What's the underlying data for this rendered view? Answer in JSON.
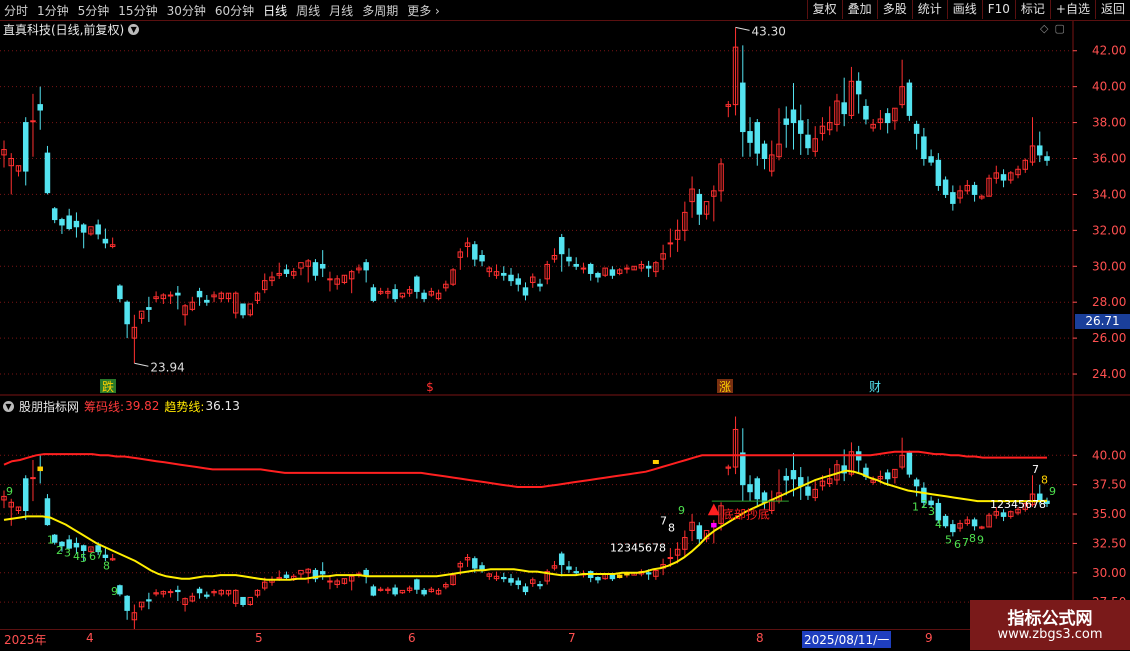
{
  "toolbar": {
    "periods": [
      "分时",
      "1分钟",
      "5分钟",
      "15分钟",
      "30分钟",
      "60分钟",
      "日线",
      "周线",
      "月线",
      "多周期",
      "更多"
    ],
    "active_period": "日线",
    "buttons": [
      "复权",
      "叠加",
      "多股",
      "统计",
      "画线",
      "F10",
      "标记",
      "+自选",
      "返回"
    ]
  },
  "main": {
    "stock_title": "直真科技(日线,前复权)",
    "current_price": "26.71"
  },
  "indicator": {
    "name": "股朋指标网",
    "line1_label": "筹码线:",
    "line1_value": "39.82",
    "line2_label": "趋势线:",
    "line2_value": "36.13"
  },
  "date_axis": {
    "labels": [
      "2025年",
      "4",
      "5",
      "6",
      "7",
      "8",
      "2025/08/11/一",
      "9"
    ]
  },
  "watermark": {
    "line1": "指标公式网",
    "line2": "www.zbgs3.com"
  },
  "colors": {
    "up": "#ff3030",
    "down": "#54e3f0",
    "chip": "#ff2020",
    "trend": "#ffee00",
    "grid": "#7a1414",
    "axis": "#ff5050"
  },
  "chart_data": [
    {
      "type": "candlestick",
      "title": "直真科技(日线,前复权)",
      "ylim": [
        23,
        43.6
      ],
      "y_ticks": [
        "42.00",
        "40.00",
        "38.00",
        "36.00",
        "34.00",
        "32.00",
        "30.00",
        "28.00",
        "26.00",
        "24.00"
      ],
      "annotations": {
        "high": "43.30",
        "low": "23.94"
      },
      "event_markers": [
        "跌",
        "$",
        "涨",
        "财"
      ],
      "candles": [
        [
          36.2,
          37.0,
          36.5,
          35.5
        ],
        [
          35.6,
          36.3,
          36.0,
          34.0
        ],
        [
          35.3,
          35.6,
          35.6,
          35.0
        ],
        [
          38.0,
          38.3,
          35.3,
          34.5
        ],
        [
          38.1,
          39.6,
          38.1,
          36.1
        ],
        [
          39.0,
          40.0,
          38.7,
          37.6
        ],
        [
          36.3,
          36.7,
          34.1,
          34.0
        ],
        [
          33.2,
          33.3,
          32.6,
          32.4
        ],
        [
          32.6,
          32.7,
          32.3,
          31.8
        ],
        [
          32.8,
          33.2,
          32.1,
          32.0
        ],
        [
          32.5,
          33.0,
          32.2,
          31.6
        ],
        [
          32.3,
          32.4,
          31.9,
          31.0
        ],
        [
          31.8,
          32.1,
          32.2,
          31.7
        ],
        [
          32.3,
          32.6,
          31.8,
          31.5
        ],
        [
          31.5,
          32.1,
          31.3,
          31.0
        ],
        [
          31.1,
          31.6,
          31.2,
          31.0
        ],
        [
          28.9,
          29.0,
          28.2,
          28.0
        ],
        [
          28.0,
          28.1,
          26.8,
          26.0
        ],
        [
          26.0,
          27.3,
          26.6,
          24.6
        ],
        [
          27.1,
          27.4,
          27.5,
          26.8
        ],
        [
          27.7,
          28.3,
          27.6,
          26.9
        ],
        [
          28.2,
          28.6,
          28.3,
          28.0
        ],
        [
          28.2,
          28.5,
          28.4,
          27.9
        ],
        [
          28.4,
          28.6,
          28.4,
          27.9
        ],
        [
          28.5,
          28.9,
          28.4,
          27.6
        ],
        [
          27.3,
          27.9,
          27.8,
          26.7
        ],
        [
          27.6,
          28.3,
          28.0,
          27.5
        ],
        [
          28.6,
          28.8,
          28.3,
          27.8
        ],
        [
          28.1,
          28.4,
          28.0,
          27.8
        ],
        [
          28.3,
          28.6,
          28.4,
          28.0
        ],
        [
          28.2,
          28.6,
          28.5,
          28.0
        ],
        [
          28.2,
          28.5,
          28.5,
          28.0
        ],
        [
          27.4,
          28.6,
          28.5,
          27.1
        ],
        [
          27.9,
          27.9,
          27.3,
          27.1
        ],
        [
          27.3,
          27.6,
          27.9,
          27.2
        ],
        [
          28.1,
          28.6,
          28.5,
          27.9
        ],
        [
          28.7,
          29.6,
          29.2,
          28.5
        ],
        [
          29.2,
          29.7,
          29.4,
          28.9
        ],
        [
          29.5,
          30.2,
          29.6,
          29.3
        ],
        [
          29.8,
          30.1,
          29.6,
          29.4
        ],
        [
          29.5,
          29.9,
          29.7,
          29.3
        ],
        [
          29.9,
          29.9,
          30.2,
          29.5
        ],
        [
          30.0,
          30.4,
          30.3,
          29.1
        ],
        [
          30.2,
          30.4,
          29.5,
          29.2
        ],
        [
          30.1,
          30.9,
          29.9,
          29.4
        ],
        [
          29.3,
          29.7,
          29.3,
          28.6
        ],
        [
          29.0,
          29.5,
          29.3,
          28.7
        ],
        [
          29.1,
          29.5,
          29.5,
          29.0
        ],
        [
          29.3,
          29.8,
          29.7,
          28.5
        ],
        [
          29.8,
          30.1,
          29.9,
          29.6
        ],
        [
          30.2,
          30.4,
          29.8,
          29.1
        ],
        [
          28.8,
          29.0,
          28.1,
          28.0
        ],
        [
          28.5,
          28.8,
          28.6,
          28.4
        ],
        [
          28.5,
          28.8,
          28.6,
          28.2
        ],
        [
          28.7,
          29.0,
          28.2,
          28.0
        ],
        [
          28.3,
          28.4,
          28.5,
          28.2
        ],
        [
          28.5,
          28.9,
          28.7,
          28.3
        ],
        [
          29.4,
          29.5,
          28.6,
          28.2
        ],
        [
          28.5,
          28.7,
          28.2,
          28.0
        ],
        [
          28.4,
          28.8,
          28.6,
          28.3
        ],
        [
          28.2,
          28.7,
          28.5,
          28.1
        ],
        [
          28.8,
          29.2,
          29.0,
          28.6
        ],
        [
          29.0,
          29.9,
          29.8,
          28.9
        ],
        [
          30.5,
          31.0,
          30.8,
          29.8
        ],
        [
          31.1,
          31.6,
          31.3,
          30.5
        ],
        [
          31.2,
          31.4,
          30.4,
          30.0
        ],
        [
          30.6,
          30.9,
          30.3,
          30.0
        ],
        [
          29.7,
          30.0,
          29.9,
          29.4
        ],
        [
          29.5,
          30.1,
          29.7,
          29.3
        ],
        [
          29.6,
          30.0,
          29.5,
          29.2
        ],
        [
          29.5,
          29.9,
          29.2,
          28.9
        ],
        [
          29.3,
          29.6,
          29.0,
          28.6
        ],
        [
          28.8,
          29.1,
          28.4,
          28.1
        ],
        [
          29.1,
          29.6,
          29.4,
          28.8
        ],
        [
          29.0,
          29.3,
          28.9,
          28.6
        ],
        [
          29.3,
          30.3,
          30.1,
          29.0
        ],
        [
          30.4,
          31.0,
          30.6,
          30.2
        ],
        [
          31.6,
          31.8,
          30.7,
          29.7
        ],
        [
          30.5,
          31.0,
          30.3,
          30.0
        ],
        [
          30.1,
          30.5,
          30.0,
          29.8
        ],
        [
          29.9,
          30.2,
          29.9,
          29.6
        ],
        [
          30.1,
          30.2,
          29.6,
          29.2
        ],
        [
          29.6,
          29.7,
          29.4,
          29.1
        ],
        [
          29.5,
          29.9,
          29.9,
          29.4
        ],
        [
          29.8,
          30.0,
          29.5,
          29.3
        ],
        [
          29.6,
          29.9,
          29.8,
          29.5
        ],
        [
          29.9,
          30.1,
          29.9,
          29.6
        ],
        [
          29.8,
          30.0,
          30.0,
          29.8
        ],
        [
          29.9,
          30.3,
          30.1,
          29.7
        ],
        [
          30.0,
          30.3,
          29.9,
          29.4
        ],
        [
          29.7,
          30.3,
          30.2,
          29.4
        ],
        [
          30.4,
          31.2,
          30.7,
          29.8
        ],
        [
          31.3,
          32.1,
          31.3,
          30.5
        ],
        [
          31.5,
          32.6,
          32.0,
          30.8
        ],
        [
          32.0,
          33.6,
          33.0,
          31.4
        ],
        [
          33.6,
          35.0,
          34.3,
          32.7
        ],
        [
          34.0,
          34.3,
          32.9,
          32.3
        ],
        [
          32.9,
          33.4,
          33.6,
          32.6
        ],
        [
          33.9,
          34.5,
          34.2,
          32.5
        ],
        [
          34.2,
          36.0,
          35.7,
          33.6
        ],
        [
          38.9,
          39.2,
          39.0,
          38.3
        ],
        [
          39.0,
          43.3,
          42.2,
          38.4
        ],
        [
          40.2,
          42.3,
          37.5,
          36.1
        ],
        [
          37.5,
          38.3,
          36.9,
          36.1
        ],
        [
          38.0,
          38.2,
          36.3,
          35.6
        ],
        [
          36.8,
          37.0,
          36.0,
          35.4
        ],
        [
          35.3,
          37.0,
          36.2,
          35.0
        ],
        [
          36.1,
          38.8,
          36.8,
          35.9
        ],
        [
          38.2,
          38.9,
          37.9,
          36.6
        ],
        [
          38.7,
          40.2,
          38.0,
          36.5
        ],
        [
          38.1,
          39.0,
          37.4,
          36.2
        ],
        [
          37.3,
          38.2,
          36.6,
          36.2
        ],
        [
          36.4,
          37.8,
          37.1,
          36.1
        ],
        [
          37.4,
          38.3,
          37.8,
          37.0
        ],
        [
          37.6,
          38.9,
          38.0,
          37.3
        ],
        [
          37.9,
          39.6,
          39.2,
          37.5
        ],
        [
          39.1,
          40.5,
          38.5,
          37.8
        ],
        [
          38.4,
          41.1,
          40.3,
          38.2
        ],
        [
          40.3,
          40.8,
          39.6,
          38.5
        ],
        [
          38.9,
          39.3,
          38.2,
          37.9
        ],
        [
          37.7,
          38.2,
          37.9,
          37.5
        ],
        [
          38.0,
          38.7,
          38.2,
          37.6
        ],
        [
          38.5,
          38.8,
          38.0,
          37.4
        ],
        [
          38.1,
          38.8,
          38.8,
          37.6
        ],
        [
          39.0,
          41.5,
          40.0,
          38.8
        ],
        [
          40.2,
          40.4,
          38.4,
          38.1
        ],
        [
          37.9,
          38.1,
          37.4,
          36.5
        ],
        [
          37.2,
          37.7,
          36.0,
          35.6
        ],
        [
          36.1,
          36.5,
          35.8,
          35.6
        ],
        [
          35.9,
          36.3,
          34.5,
          34.2
        ],
        [
          34.8,
          35.0,
          34.0,
          33.8
        ],
        [
          34.1,
          34.5,
          33.5,
          33.1
        ],
        [
          33.8,
          34.5,
          34.2,
          33.5
        ],
        [
          34.2,
          34.8,
          34.5,
          34.0
        ],
        [
          34.5,
          34.7,
          34.0,
          33.6
        ],
        [
          33.8,
          34.0,
          33.9,
          33.7
        ],
        [
          33.9,
          35.1,
          34.9,
          33.9
        ],
        [
          34.9,
          35.6,
          35.2,
          34.6
        ],
        [
          35.1,
          35.4,
          34.8,
          34.4
        ],
        [
          34.8,
          35.3,
          35.2,
          34.6
        ],
        [
          35.1,
          35.6,
          35.4,
          34.9
        ],
        [
          35.4,
          36.0,
          35.9,
          35.2
        ],
        [
          35.8,
          38.3,
          36.7,
          35.6
        ],
        [
          36.7,
          37.5,
          36.2,
          35.8
        ],
        [
          36.1,
          36.4,
          35.9,
          35.6
        ]
      ]
    },
    {
      "type": "line",
      "title": "股朋指标网",
      "ylim": [
        25.3,
        43.6
      ],
      "y_ticks": [
        "40.00",
        "37.50",
        "35.00",
        "32.50",
        "30.00",
        "27.50"
      ],
      "series": [
        {
          "name": "筹码线",
          "color": "#ff2020",
          "values": [
            39.2,
            39.5,
            39.6,
            39.8,
            40.0,
            40.1,
            40.1,
            40.1,
            40.1,
            40.1,
            40.1,
            40.1,
            40.0,
            40.0,
            39.9,
            39.9,
            39.8,
            39.7,
            39.6,
            39.5,
            39.4,
            39.3,
            39.2,
            39.1,
            39.0,
            38.9,
            38.8,
            38.8,
            38.8,
            38.8,
            38.8,
            38.8,
            38.8,
            38.7,
            38.6,
            38.5,
            38.5,
            38.5,
            38.5,
            38.5,
            38.5,
            38.5,
            38.5,
            38.5,
            38.5,
            38.5,
            38.5,
            38.5,
            38.5,
            38.5,
            38.5,
            38.5,
            38.5,
            38.4,
            38.3,
            38.2,
            38.1,
            38.0,
            37.9,
            37.8,
            37.7,
            37.6,
            37.5,
            37.4,
            37.3,
            37.3,
            37.3,
            37.3,
            37.4,
            37.5,
            37.6,
            37.7,
            37.8,
            37.9,
            38.0,
            38.1,
            38.2,
            38.3,
            38.4,
            38.5,
            38.6,
            38.8,
            39.0,
            39.2,
            39.4,
            39.6,
            39.8,
            40.0,
            40.0,
            40.0,
            40.0,
            40.0,
            40.0,
            40.0,
            40.0,
            40.0,
            40.0,
            40.0,
            40.0,
            40.0,
            40.0,
            40.0,
            40.0,
            40.0,
            40.0,
            40.0,
            40.0,
            40.0,
            40.0,
            40.1,
            40.2,
            40.3,
            40.3,
            40.3,
            40.3,
            40.2,
            40.1,
            40.1,
            40.0,
            40.0,
            39.9,
            39.9,
            39.8,
            39.8,
            39.8,
            39.8,
            39.8,
            39.8,
            39.8,
            39.8,
            39.8
          ]
        },
        {
          "name": "趋势线",
          "color": "#ffee00",
          "values": [
            34.5,
            34.6,
            34.7,
            34.8,
            34.8,
            34.8,
            34.7,
            34.4,
            34.1,
            33.7,
            33.3,
            32.9,
            32.5,
            32.2,
            31.9,
            31.6,
            31.3,
            31.0,
            30.6,
            30.2,
            29.9,
            29.7,
            29.6,
            29.5,
            29.5,
            29.6,
            29.7,
            29.7,
            29.8,
            29.8,
            29.8,
            29.7,
            29.6,
            29.5,
            29.4,
            29.4,
            29.4,
            29.4,
            29.5,
            29.5,
            29.6,
            29.7,
            29.7,
            29.8,
            29.8,
            29.8,
            29.8,
            29.7,
            29.7,
            29.7,
            29.7,
            29.7,
            29.7,
            29.7,
            29.7,
            29.7,
            29.7,
            29.8,
            29.9,
            30.0,
            30.1,
            30.2,
            30.2,
            30.3,
            30.3,
            30.3,
            30.3,
            30.2,
            30.1,
            30.1,
            30.0,
            29.9,
            29.8,
            29.8,
            29.8,
            29.9,
            29.9,
            29.9,
            29.9,
            29.9,
            30.0,
            30.0,
            30.0,
            30.1,
            30.3,
            30.4,
            30.6,
            30.9,
            31.3,
            31.8,
            32.4,
            33.1,
            33.6,
            34.0,
            34.4,
            34.8,
            35.2,
            35.5,
            35.8,
            36.1,
            36.4,
            36.7,
            37.0,
            37.3,
            37.6,
            37.9,
            38.1,
            38.3,
            38.5,
            38.7,
            38.6,
            38.4,
            38.1,
            37.9,
            37.6,
            37.4,
            37.2,
            37.0,
            36.9,
            36.8,
            36.7,
            36.6,
            36.5,
            36.4,
            36.3,
            36.2,
            36.1,
            36.1,
            36.1,
            36.1,
            36.1,
            36.1,
            36.1,
            36.1,
            36.1,
            36.13
          ]
        }
      ],
      "annotation_text": "底部抄底",
      "count_labels": [
        "9",
        "1",
        "2",
        "3",
        "4",
        "5",
        "6",
        "7",
        "8",
        "9",
        "12345678",
        "7",
        "8",
        "9",
        "1",
        "2",
        "3",
        "4",
        "5",
        "6",
        "7",
        "8",
        "9",
        "12345678",
        "7",
        "8",
        "9"
      ]
    }
  ]
}
